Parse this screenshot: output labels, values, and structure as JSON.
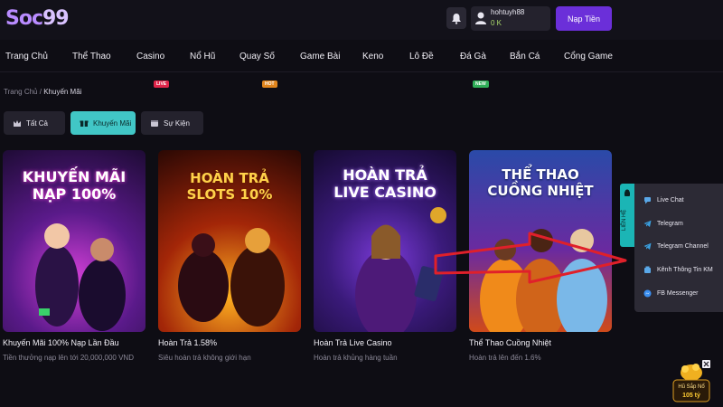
{
  "header": {
    "logo": {
      "main": "Soc",
      "suffix": "99"
    },
    "user": {
      "name": "hohtuyh88",
      "balance": "0 K"
    },
    "deposit_label": "Nạp Tiền"
  },
  "nav": {
    "items": [
      {
        "label": "Trang Chủ"
      },
      {
        "label": "Thể Thao"
      },
      {
        "label": "Casino",
        "badge": "LIVE"
      },
      {
        "label": "Nổ Hũ"
      },
      {
        "label": "Quay Số",
        "badge": "HOT"
      },
      {
        "label": "Game Bài"
      },
      {
        "label": "Keno"
      },
      {
        "label": "Lô Đề"
      },
      {
        "label": "Đá Gà",
        "badge": "NEW"
      },
      {
        "label": "Bắn Cá"
      },
      {
        "label": "Cổng Game"
      }
    ]
  },
  "breadcrumb": {
    "home": "Trang Chủ",
    "separator": "/",
    "current": "Khuyến Mãi"
  },
  "tabs": [
    {
      "label": "Tất Cả",
      "icon": "crown-icon"
    },
    {
      "label": "Khuyến Mãi",
      "icon": "gift-icon"
    },
    {
      "label": "Sự Kiện",
      "icon": "calendar-icon"
    }
  ],
  "promos": [
    {
      "art_line1": "KHUYẾN MÃI",
      "art_line2": "NẠP 100%",
      "name": "Khuyến Mãi 100% Nạp Lần Đầu",
      "desc": "Tiền thưởng nạp lên tới 20,000,000 VND"
    },
    {
      "art_line1": "HOÀN TRẢ",
      "art_line2": "SLOTS 10%",
      "name": "Hoàn Trả 1.58%",
      "desc": "Siêu hoàn trả không giới hạn"
    },
    {
      "art_line1": "HOÀN TRẢ",
      "art_line2": "LIVE CASINO",
      "name": "Hoàn Trả Live Casino",
      "desc": "Hoàn trả khủng hàng tuần"
    },
    {
      "art_line1": "THỂ THAO",
      "art_line2": "CUỒNG NHIỆT",
      "name": "Thể Thao Cuồng Nhiệt",
      "desc": "Hoàn trả lên đến 1.6%"
    }
  ],
  "contact": {
    "tab_label": "LIÊN HỆ",
    "items": [
      {
        "label": "Live Chat"
      },
      {
        "label": "Telegram"
      },
      {
        "label": "Telegram Channel"
      },
      {
        "label": "Kênh Thông Tin KM"
      },
      {
        "label": "FB Messenger"
      }
    ]
  },
  "jackpot": {
    "line1": "Hũ Sắp Nổ",
    "line2": "105 tỷ"
  },
  "colors": {
    "accent": "#6b2fd9",
    "teal": "#41c6c6",
    "bg": "#0e0d14",
    "arrow": "#e0202a"
  }
}
